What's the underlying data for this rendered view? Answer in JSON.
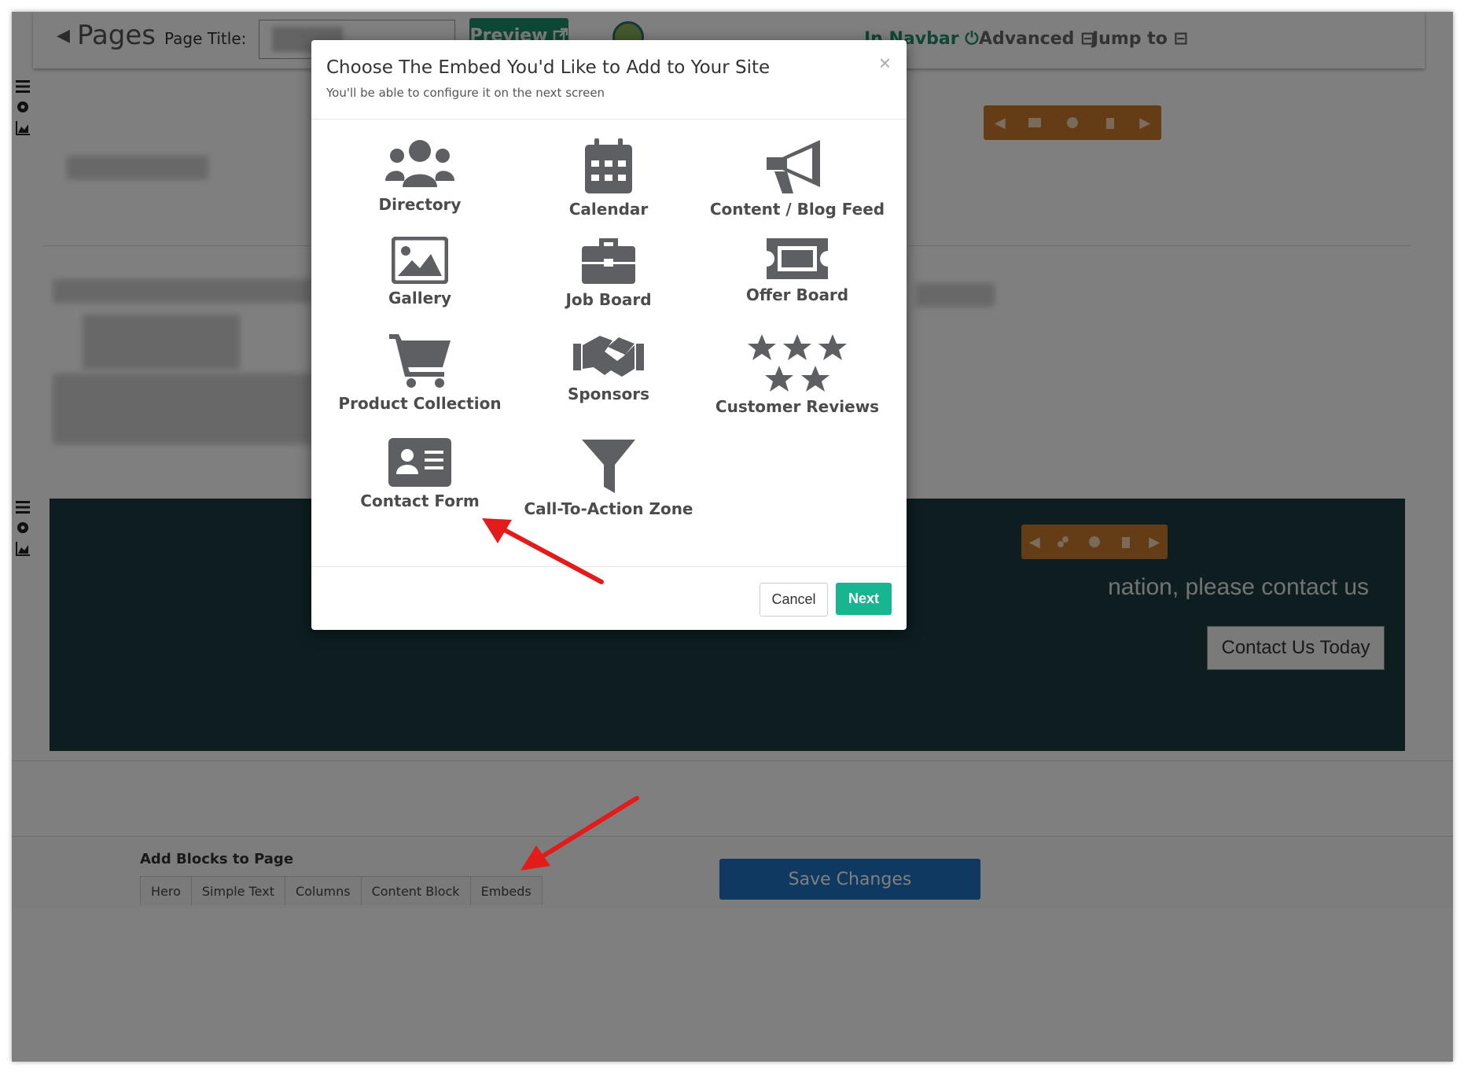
{
  "topbar": {
    "pages_label": "Pages",
    "page_title_label": "Page Title:",
    "preview_label": "Preview",
    "in_navbar_label": "In Navbar",
    "advanced_label": "Advanced",
    "jump_to_label": "Jump to"
  },
  "cta": {
    "text": "nation, please contact us",
    "button_label": "Contact Us Today"
  },
  "bottom": {
    "add_blocks_label": "Add Blocks to Page",
    "tabs": [
      "Hero",
      "Simple Text",
      "Columns",
      "Content Block",
      "Embeds"
    ],
    "save_label": "Save Changes"
  },
  "modal": {
    "title": "Choose The Embed You'd Like to Add to Your Site",
    "subtitle": "You'll be able to configure it on the next screen",
    "close_symbol": "×",
    "items": [
      {
        "label": "Directory",
        "icon": "users-icon"
      },
      {
        "label": "Calendar",
        "icon": "calendar-icon"
      },
      {
        "label": "Content / Blog Feed",
        "icon": "megaphone-icon"
      },
      {
        "label": "Gallery",
        "icon": "image-icon"
      },
      {
        "label": "Job Board",
        "icon": "briefcase-icon"
      },
      {
        "label": "Offer Board",
        "icon": "ticket-icon"
      },
      {
        "label": "Product Collection",
        "icon": "cart-icon"
      },
      {
        "label": "Sponsors",
        "icon": "handshake-icon"
      },
      {
        "label": "Customer Reviews",
        "icon": "stars-icon"
      },
      {
        "label": "Contact Form",
        "icon": "id-card-icon"
      },
      {
        "label": "Call-To-Action Zone",
        "icon": "funnel-icon"
      }
    ],
    "cancel_label": "Cancel",
    "next_label": "Next"
  },
  "colors": {
    "accent_green": "#18b690",
    "preview_green": "#1e8f6d",
    "toolbar_orange": "#c9782a",
    "dark_band": "#1b3a40",
    "save_blue": "#1f73c0",
    "annotation_red": "#e31b1b",
    "icon_gray": "#5d5f62"
  }
}
